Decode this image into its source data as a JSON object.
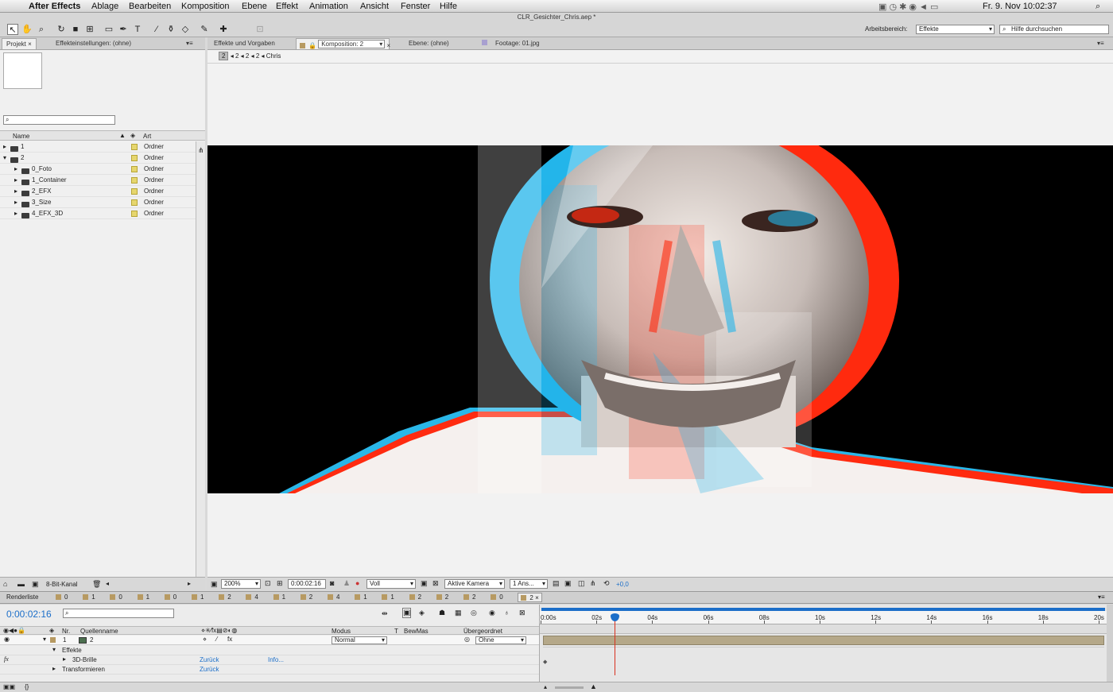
{
  "menubar": {
    "app": "After Effects",
    "items": [
      "Ablage",
      "Bearbeiten",
      "Komposition",
      "Ebene",
      "Effekt",
      "Animation",
      "Ansicht",
      "Fenster",
      "Hilfe"
    ],
    "clock": "Fr. 9. Nov  10:02:37"
  },
  "window_title": "CLR_Gesichter_Chris.aep *",
  "toolbar": {
    "workspace_label": "Arbeitsbereich:",
    "workspace_value": "Effekte",
    "help_placeholder": "Hilfe durchsuchen"
  },
  "tabs_left": {
    "project": "Projekt",
    "effects_settings": "Effekteinstellungen: (ohne)"
  },
  "tabs_right": {
    "effects_presets": "Effekte und Vorgaben",
    "composition": "Komposition: 2",
    "layer": "Ebene: (ohne)",
    "footage": "Footage: 01.jpg"
  },
  "breadcrumb": [
    "2",
    "2",
    "2",
    "2",
    "Chris"
  ],
  "project": {
    "columns": {
      "name": "Name",
      "type": "Art"
    },
    "items": [
      {
        "name": "1",
        "type": "Ordner",
        "indent": 0,
        "open": false
      },
      {
        "name": "2",
        "type": "Ordner",
        "indent": 0,
        "open": true
      },
      {
        "name": "0_Foto",
        "type": "Ordner",
        "indent": 1,
        "open": false
      },
      {
        "name": "1_Container",
        "type": "Ordner",
        "indent": 1,
        "open": false
      },
      {
        "name": "2_EFX",
        "type": "Ordner",
        "indent": 1,
        "open": false
      },
      {
        "name": "3_Size",
        "type": "Ordner",
        "indent": 1,
        "open": false
      },
      {
        "name": "4_EFX_3D",
        "type": "Ordner",
        "indent": 1,
        "open": false
      }
    ],
    "bit_depth": "8-Bit-Kanal"
  },
  "viewer_footer": {
    "zoom": "200%",
    "timecode": "0:00:02:16",
    "resolution": "Voll",
    "camera": "Aktive Kamera",
    "views": "1 Ans...",
    "exposure": "+0,0"
  },
  "bottom_tabs": [
    "Renderliste",
    "0",
    "1",
    "0",
    "1",
    "0",
    "1",
    "2",
    "4",
    "1",
    "2",
    "4",
    "1",
    "1",
    "2",
    "2",
    "2",
    "0",
    "2"
  ],
  "timeline": {
    "timecode": "0:00:02:16",
    "columns": {
      "nr": "Nr.",
      "source": "Quellenname",
      "mode": "Modus",
      "t": "T",
      "trkmat": "BewMas",
      "parent": "Übergeordnet"
    },
    "layer": {
      "nr": "1",
      "name": "2",
      "mode": "Normal",
      "parent": "Ohne"
    },
    "effects_label": "Effekte",
    "effect_name": "3D-Brille",
    "reset": "Zurück",
    "info": "Info...",
    "transform": "Transformieren",
    "ruler": [
      "0:00s",
      "02s",
      "04s",
      "06s",
      "08s",
      "10s",
      "12s",
      "14s",
      "16s",
      "18s",
      "20s"
    ],
    "playhead_seconds": 2.64,
    "ruler_max_seconds": 20
  },
  "colors": {
    "accent": "#1c6fc9",
    "layer_bar": "#b5a889",
    "swatch": "#e6d66e"
  }
}
